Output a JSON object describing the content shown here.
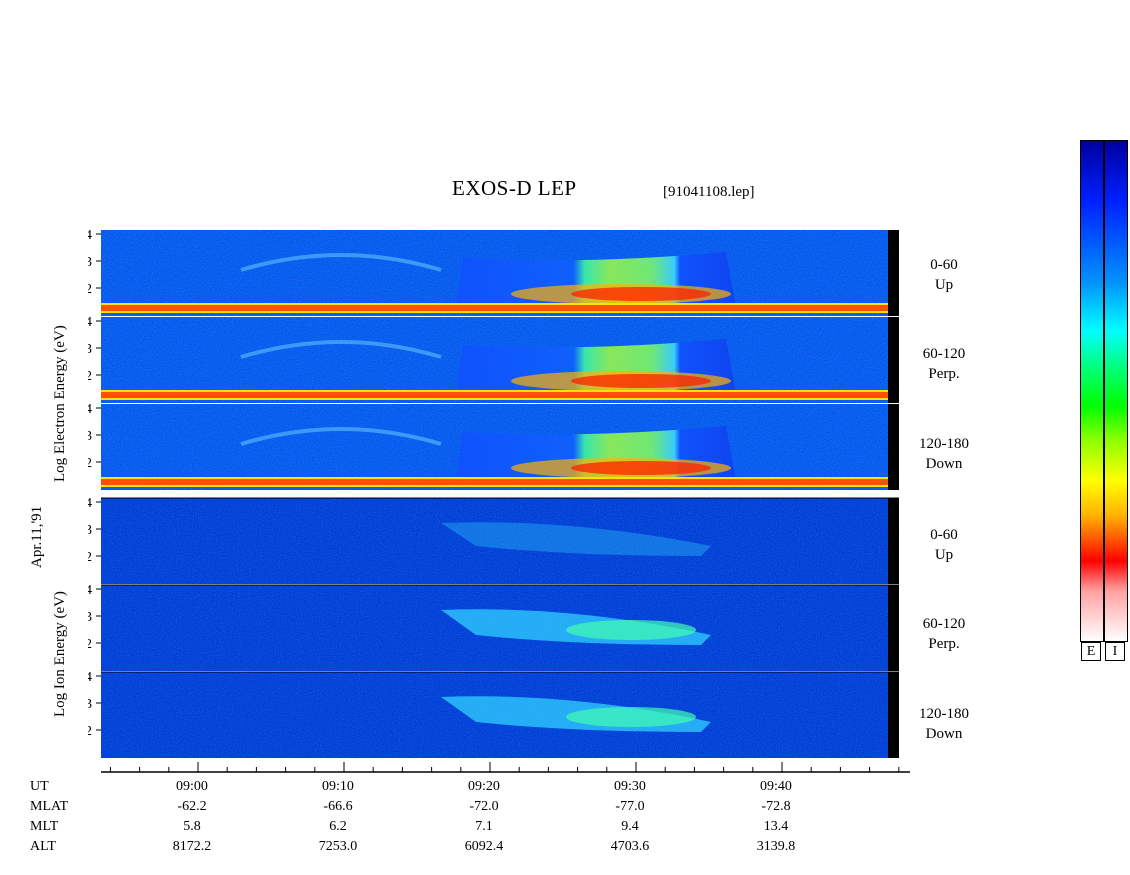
{
  "header": {
    "title": "EXOS-D LEP",
    "file": "[91041108.lep]"
  },
  "side": {
    "date": "Apr.11,'91",
    "electron_label": "Log Electron Energy (eV)",
    "ion_label": "Log Ion Energy (eV)"
  },
  "panels": [
    {
      "species": "electron",
      "angle": "0-60",
      "dir": "Up"
    },
    {
      "species": "electron",
      "angle": "60-120",
      "dir": "Perp."
    },
    {
      "species": "electron",
      "angle": "120-180",
      "dir": "Down"
    },
    {
      "species": "ion",
      "angle": "0-60",
      "dir": "Up"
    },
    {
      "species": "ion",
      "angle": "60-120",
      "dir": "Perp."
    },
    {
      "species": "ion",
      "angle": "120-180",
      "dir": "Down"
    }
  ],
  "yticks": [
    "4",
    "3",
    "2"
  ],
  "footer": {
    "rows": [
      "UT",
      "MLAT",
      "MLT",
      "ALT"
    ],
    "columns": [
      {
        "UT": "09:00",
        "MLAT": "-62.2",
        "MLT": "5.8",
        "ALT": "8172.2"
      },
      {
        "UT": "09:10",
        "MLAT": "-66.6",
        "MLT": "6.2",
        "ALT": "7253.0"
      },
      {
        "UT": "09:20",
        "MLAT": "-72.0",
        "MLT": "7.1",
        "ALT": "6092.4"
      },
      {
        "UT": "09:30",
        "MLAT": "-77.0",
        "MLT": "9.4",
        "ALT": "4703.6"
      },
      {
        "UT": "09:40",
        "MLAT": "-72.8",
        "MLT": "13.4",
        "ALT": "3139.8"
      }
    ]
  },
  "colorbar": {
    "labels": [
      "E",
      "I"
    ],
    "colors": [
      "#000080",
      "#0030ff",
      "#00a0ff",
      "#00ffff",
      "#00ff80",
      "#00ff00",
      "#a0ff00",
      "#ffff00",
      "#ffa000",
      "#ff4000",
      "#ff0000",
      "#ffc0c0",
      "#ffffff"
    ]
  },
  "chart_data": {
    "type": "heatmap",
    "title": "EXOS-D LEP",
    "xlabel": "UT",
    "x_ticks": [
      "09:00",
      "09:10",
      "09:20",
      "09:30",
      "09:40"
    ],
    "y_ticks": [
      2,
      3,
      4
    ],
    "series": [
      {
        "name": "0-60 Up",
        "ylabel": "Log Electron Energy (eV)"
      },
      {
        "name": "60-120 Perp.",
        "ylabel": "Log Electron Energy (eV)"
      },
      {
        "name": "120-180 Down",
        "ylabel": "Log Electron Energy (eV)"
      },
      {
        "name": "0-60 Up",
        "ylabel": "Log Ion Energy (eV)"
      },
      {
        "name": "60-120 Perp.",
        "ylabel": "Log Ion Energy (eV)"
      },
      {
        "name": "120-180 Down",
        "ylabel": "Log Ion Energy (eV)"
      }
    ]
  }
}
